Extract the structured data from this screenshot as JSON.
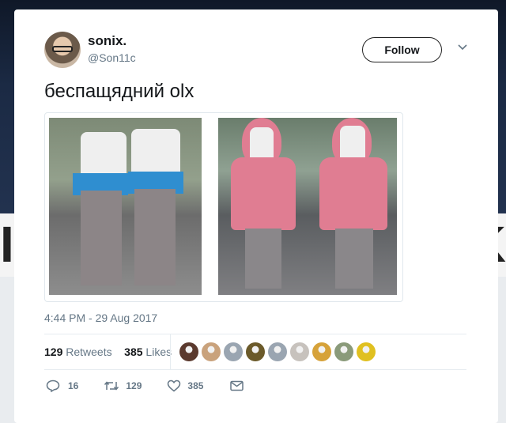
{
  "background": {
    "left_letter": "I",
    "right_letter": "K"
  },
  "tweet": {
    "display_name": "sonix.",
    "handle": "@Son11c",
    "follow_label": "Follow",
    "text": "беспащядний olx",
    "timestamp": "4:44 PM - 29 Aug 2017",
    "retweets_count": "129",
    "retweets_label": "Retweets",
    "likes_count": "385",
    "likes_label": "Likes",
    "actions": {
      "replies": "16",
      "retweets": "129",
      "likes": "385"
    },
    "likers": [
      "#5b3a2e",
      "#c9a27c",
      "#9aa5b1",
      "#6b5a2a",
      "#9aa5b1",
      "#c7c2bd",
      "#d6a23a",
      "#8a9a7a",
      "#e0c020"
    ]
  },
  "colors": {
    "text": "#14171a",
    "muted": "#657786",
    "border": "#e1e8ed"
  }
}
